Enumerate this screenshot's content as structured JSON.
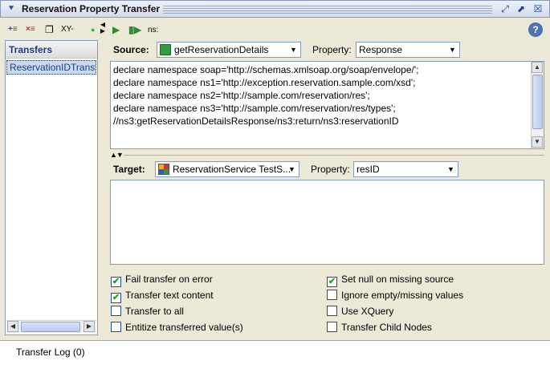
{
  "window": {
    "title": "Reservation Property Transfer",
    "title_icon": "collapse-arrow-icon",
    "controls": [
      "detach-icon",
      "maximize-icon",
      "close-icon"
    ]
  },
  "left_toolbar": {
    "add_icon": "add-transfer-icon",
    "remove_icon": "remove-transfer-icon",
    "clone_icon": "clone-transfer-icon",
    "xy_label": "XY-"
  },
  "transfers": {
    "header": "Transfers",
    "items": [
      "ReservationIDTransfer"
    ]
  },
  "right_toolbar": {
    "run_icon": "run-icon",
    "run_all_icon": "run-all-icon",
    "ns_label": "ns:",
    "help_icon": "help-icon"
  },
  "source": {
    "label": "Source:",
    "step": "getReservationDetails",
    "property_label": "Property:",
    "property": "Response",
    "code": [
      "declare namespace soap='http://schemas.xmlsoap.org/soap/envelope/';",
      "declare namespace ns1='http://exception.reservation.sample.com/xsd';",
      "declare namespace ns2='http://sample.com/reservation/res';",
      "declare namespace ns3='http://sample.com/reservation/res/types';",
      "//ns3:getReservationDetailsResponse/ns3:return/ns3:reservationID"
    ]
  },
  "target": {
    "label": "Target:",
    "step": "ReservationService TestS...",
    "property_label": "Property:",
    "property": "resID",
    "code": ""
  },
  "options": {
    "fail_transfer_on_error": {
      "label": "Fail transfer on error",
      "checked": true
    },
    "transfer_text_content": {
      "label": "Transfer text content",
      "checked": true
    },
    "transfer_to_all": {
      "label": "Transfer to all",
      "checked": false
    },
    "entitize_values": {
      "label": "Entitize transferred value(s)",
      "checked": false
    },
    "set_null_missing": {
      "label": "Set null on missing source",
      "checked": true
    },
    "ignore_empty": {
      "label": "Ignore empty/missing values",
      "checked": false
    },
    "use_xquery": {
      "label": "Use XQuery",
      "checked": false
    },
    "transfer_child_nodes": {
      "label": "Transfer Child Nodes",
      "checked": false
    }
  },
  "footer": {
    "transfer_log": "Transfer Log (0)"
  },
  "colors": {
    "window_bg": "#ECE9D8",
    "selection": "#C9DAF5",
    "link_blue": "#1E3F7A",
    "check_green": "#21A121"
  }
}
